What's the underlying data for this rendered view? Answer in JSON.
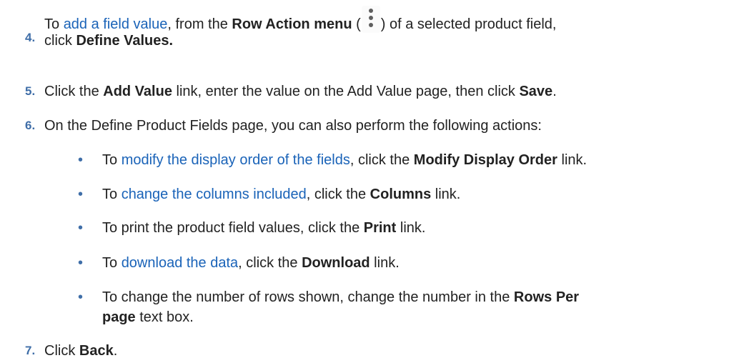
{
  "steps": [
    {
      "num": "4.",
      "p1": "To ",
      "link": "add a field value",
      "p2": ", from the ",
      "b1": "Row Action menu",
      "p3": " (",
      "icon": "vertical-ellipsis-icon",
      "p4": ") of a selected product field,",
      "p5": "click ",
      "b2": "Define Values."
    },
    {
      "num": "5.",
      "p1": "Click the ",
      "b1": "Add Value",
      "p2": " link, enter the value on the Add Value page, then click ",
      "b2": "Save",
      "p3": "."
    },
    {
      "num": "6.",
      "p1": "On the Define Product Fields page, you can also perform the following actions:"
    },
    {
      "num": "7.",
      "p1": "Click ",
      "b1": "Back",
      "p2": "."
    }
  ],
  "bullets": [
    {
      "p1": "To ",
      "link": "modify the display order of the fields",
      "p2": ", click the ",
      "b1": "Modify Display Order",
      "p3": " link."
    },
    {
      "p1": "To ",
      "link": "change the columns included",
      "p2": ", click the ",
      "b1": "Columns",
      "p3": " link."
    },
    {
      "p1": "To print the product field values, click the ",
      "b1": "Print",
      "p2": " link."
    },
    {
      "p1": "To ",
      "link": "download the data",
      "p2": ", click the ",
      "b1": "Download",
      "p3": " link."
    },
    {
      "p1": "To change the number of rows shown, change the number in the ",
      "b1": "Rows Per",
      "p2": "page",
      "p3": " text box."
    }
  ],
  "bullet_glyph": "•",
  "colors": {
    "step_number": "#3f6ea8",
    "link": "#1a63b8",
    "text": "#222222"
  }
}
